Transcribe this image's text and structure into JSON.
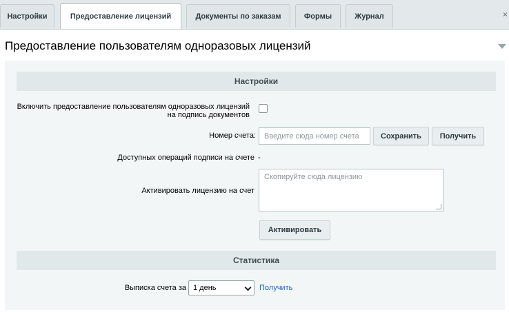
{
  "tabs": [
    {
      "label": "Настройки",
      "active": false
    },
    {
      "label": "Предоставление лицензий",
      "active": true
    },
    {
      "label": "Документы по заказам",
      "active": false
    },
    {
      "label": "Формы",
      "active": false
    },
    {
      "label": "Журнал",
      "active": false
    }
  ],
  "page_title": "Предоставление пользователям одноразовых лицензий",
  "settings": {
    "header": "Настройки",
    "enable_label_line1": "Включить предоставление пользователям одноразовых лицензий",
    "enable_label_line2": "на подпись документов",
    "enable_checked": false,
    "account_label": "Номер счета:",
    "account_placeholder": "Введите сюда номер счета",
    "save_label": "Сохранить",
    "get_label": "Получить",
    "available_label": "Доступных операций подписи на счете",
    "available_value": "-",
    "activate_label": "Активировать лицензию на счет",
    "license_placeholder": "Скопируйте сюда лицензию",
    "activate_button": "Активировать"
  },
  "statistics": {
    "header": "Статистика",
    "statement_label": "Выписка счета за",
    "period_selected": "1 день",
    "get_link": "Получить"
  },
  "colors": {
    "panel": "#f3f6f7",
    "section_header": "#e1e8ea",
    "link": "#2067b0"
  }
}
